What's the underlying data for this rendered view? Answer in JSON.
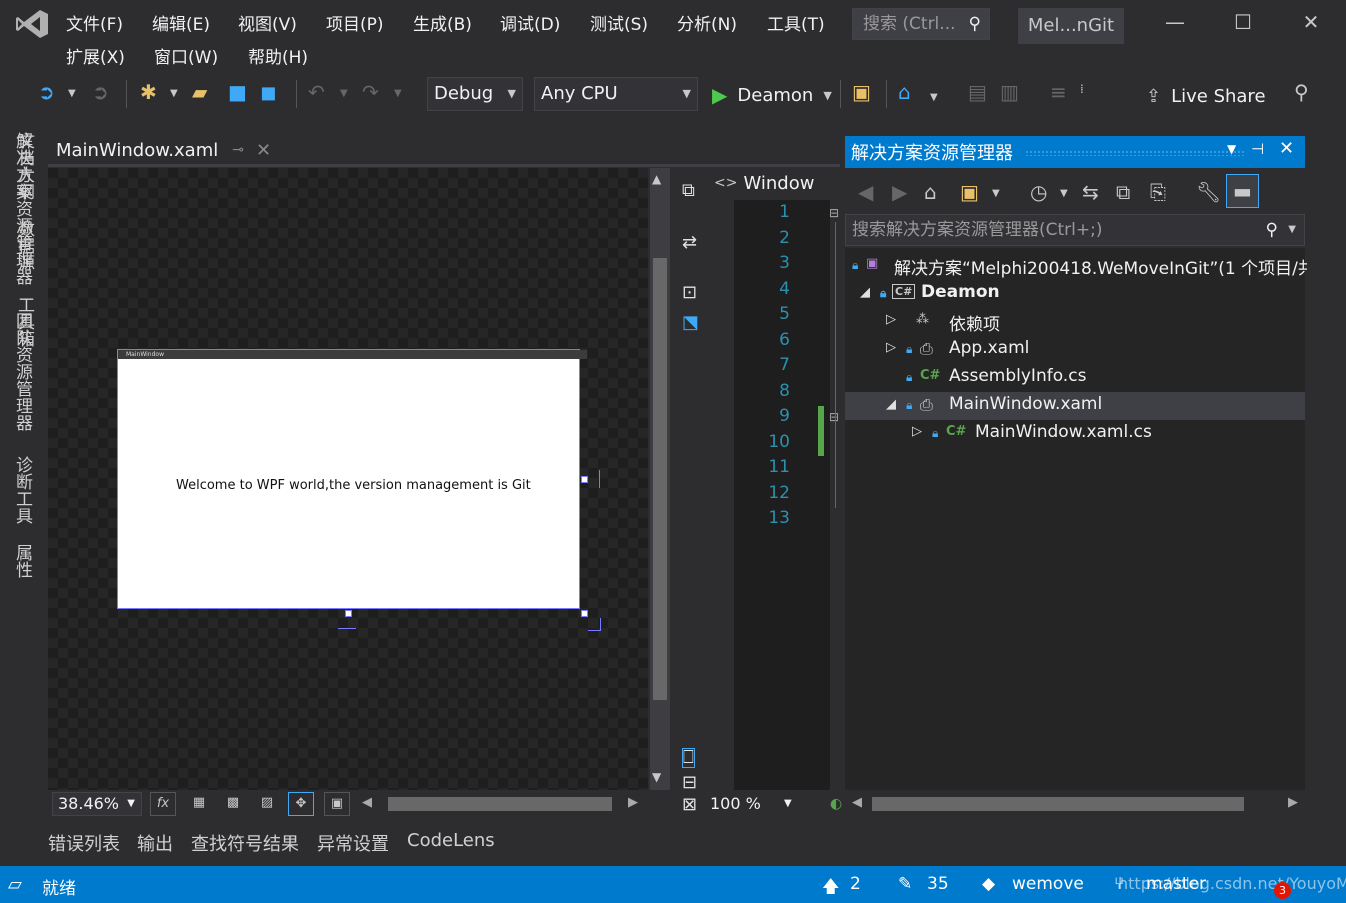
{
  "menu": {
    "items": [
      "文件(F)",
      "编辑(E)",
      "视图(V)",
      "项目(P)",
      "生成(B)",
      "调试(D)",
      "测试(S)",
      "分析(N)",
      "工具(T)",
      "扩展(X)",
      "窗口(W)",
      "帮助(H)"
    ],
    "search_placeholder": "搜索 (Ctrl...",
    "solution_title": "Mel...nGit"
  },
  "toolbar": {
    "config": "Debug",
    "platform": "Any CPU",
    "start_label": "Deamon",
    "live_share": "Live Share"
  },
  "left_tabs": [
    "文档大纲",
    "数据源",
    "工具箱"
  ],
  "editor": {
    "tab_title": "MainWindow.xaml",
    "xml_path": "Window",
    "wpf_window_title": "MainWindow",
    "wpf_text": "Welcome to WPF world,the version management is Git",
    "zoom": "38.46%",
    "code_zoom": "100 %",
    "line_numbers": [
      "1",
      "2",
      "3",
      "4",
      "5",
      "6",
      "7",
      "8",
      "9",
      "10",
      "11",
      "12",
      "13"
    ]
  },
  "solution_explorer": {
    "title": "解决方案资源管理器",
    "search_placeholder": "搜索解决方案资源管理器(Ctrl+;)",
    "solution_node": "解决方案“Melphi200418.WeMoveInGit”(1 个项目/共",
    "project_node": "Deamon",
    "dependencies": "依赖项",
    "app_xaml": "App.xaml",
    "assembly_info": "AssemblyInfo.cs",
    "main_window": "MainWindow.xaml",
    "main_window_cs": "MainWindow.xaml.cs"
  },
  "right_tabs": [
    "解决方案资源管理器",
    "团队资源管理器",
    "诊断工具",
    "属性"
  ],
  "output_tabs": [
    "错误列表",
    "输出",
    "查找符号结果",
    "异常设置",
    "CodeLens"
  ],
  "status": {
    "ready": "就绪",
    "up_count": "2",
    "edit_count": "35",
    "repo": "wemove",
    "branch": "master",
    "watermark": "https://blog.csdn.net/YouyoMei",
    "notif_count": "3"
  },
  "colors": {
    "accent": "#007acc",
    "background": "#2d2d30",
    "line_numbers": "#2b91af"
  }
}
